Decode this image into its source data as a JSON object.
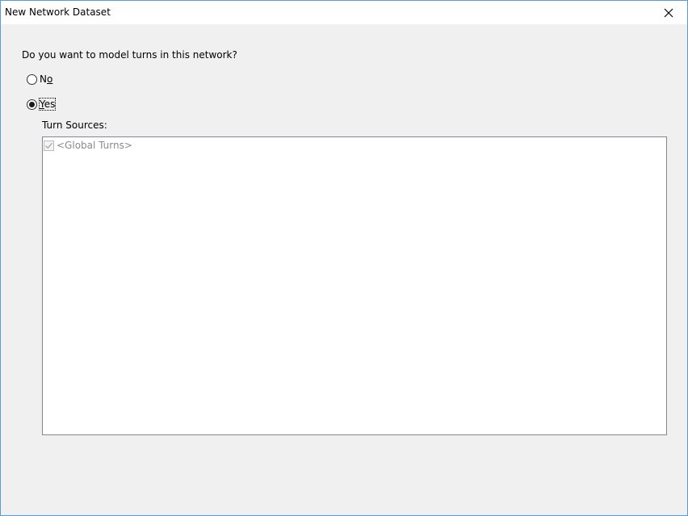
{
  "window": {
    "title": "New Network Dataset"
  },
  "question": "Do you want to model turns in this network?",
  "options": {
    "no": {
      "label_prefix": "N",
      "label_mnemonic": "o",
      "selected": false
    },
    "yes": {
      "label_prefix": "",
      "label_mnemonic": "Y",
      "label_rest": "es",
      "selected": true
    }
  },
  "turn_sources": {
    "label": "Turn Sources:",
    "items": [
      {
        "label": "<Global Turns>",
        "checked": true,
        "enabled": false
      }
    ]
  },
  "icons": {
    "close": "close-icon",
    "check": "checkmark-icon"
  }
}
